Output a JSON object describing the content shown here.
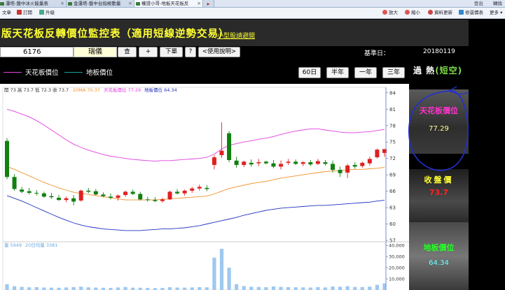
{
  "browser": {
    "tabs": [
      {
        "label": "瀑塔-盤中冰火能量表",
        "active": false
      },
      {
        "label": "金瀑塔-盤中台指極動量",
        "active": false
      },
      {
        "label": "權證小哥-地板天花板反",
        "active": true
      }
    ],
    "window_buttons": [
      "登出",
      "轉換"
    ],
    "toolbar_left": [
      "文章",
      "訂閱",
      "升級"
    ],
    "toolbar_right": [
      "放大",
      "縮小",
      "資料更新",
      "修還價表",
      "更多"
    ]
  },
  "header": {
    "title": "版天花板反轉價位監控表（適用短線逆勢交易）",
    "guide_link": "小型股請避開"
  },
  "controls": {
    "stock_code": "6176",
    "stock_name": "瑞儀",
    "query_button": "查",
    "add_button": "+",
    "order_button": "下單",
    "help_q": "?",
    "help_button": "<使用說明>",
    "base_date_label": "基準日：",
    "base_date_value": "20180119"
  },
  "legend": {
    "ceiling_label": "天花板價位",
    "floor_label": "地板價位",
    "periods": [
      "60日",
      "半年",
      "一年",
      "三年"
    ]
  },
  "right_panel": {
    "status_label": "過 熱",
    "status_short": "(短空)",
    "ceiling_title": "天花板價位",
    "ceiling_value": "77.29",
    "close_title": "收盤價",
    "close_value": "73.7",
    "floor_title": "地板價位",
    "floor_value": "64.34"
  },
  "colors": {
    "ceiling": "#e040e0",
    "floor": "#2030c0",
    "ma20": "#f0902a",
    "up": "#e02020",
    "down": "#108010",
    "volume": "#9ec8f0"
  },
  "chart_data": {
    "type": "candlestick",
    "info_text": "開 73  高 73.7  低 72.3  收 73.7",
    "ma_label": "20MA 70.37",
    "ceiling_label": "天花板價位 77.29",
    "floor_label": "地板價位 64.34",
    "volume_label": "量 5949",
    "volume_ma_label": "20日均量 3381",
    "price_ticks": [
      57,
      60,
      63,
      66,
      69,
      72,
      75,
      78,
      81,
      84
    ],
    "ylim": [
      57,
      85
    ],
    "volume_ticks": [
      "10,000",
      "20,000",
      "30,000",
      "40,000"
    ],
    "volume_ylim": [
      0,
      42000
    ],
    "ohlc": [
      [
        75.2,
        75.7,
        68.2,
        68.6
      ],
      [
        68.6,
        69.1,
        66.1,
        66.4
      ],
      [
        66.3,
        66.8,
        65.6,
        65.9
      ],
      [
        66.0,
        66.6,
        65.4,
        65.7
      ],
      [
        65.7,
        66.2,
        65.2,
        65.6
      ],
      [
        65.6,
        65.9,
        64.8,
        65.0
      ],
      [
        65.1,
        65.7,
        64.6,
        64.9
      ],
      [
        64.8,
        65.3,
        64.2,
        64.4
      ],
      [
        64.4,
        65.0,
        64.0,
        64.7
      ],
      [
        64.7,
        65.3,
        63.4,
        64.1
      ],
      [
        64.3,
        66.3,
        64.1,
        66.1
      ],
      [
        66.1,
        66.6,
        65.6,
        65.9
      ],
      [
        66.0,
        66.4,
        65.2,
        65.4
      ],
      [
        65.4,
        65.8,
        64.9,
        65.1
      ],
      [
        65.0,
        65.6,
        64.5,
        64.8
      ],
      [
        64.8,
        65.4,
        64.3,
        65.2
      ],
      [
        65.3,
        66.1,
        65.0,
        65.9
      ],
      [
        65.9,
        66.3,
        65.3,
        65.5
      ],
      [
        65.5,
        65.9,
        64.3,
        64.5
      ],
      [
        64.5,
        65.0,
        64.1,
        64.4
      ],
      [
        64.4,
        64.9,
        64.0,
        64.2
      ],
      [
        64.2,
        64.8,
        63.9,
        64.5
      ],
      [
        64.5,
        66.1,
        64.4,
        65.9
      ],
      [
        65.9,
        66.4,
        65.4,
        65.6
      ],
      [
        65.6,
        66.3,
        65.2,
        66.1
      ],
      [
        66.1,
        66.8,
        65.7,
        66.5
      ],
      [
        66.5,
        67.2,
        66.1,
        66.8
      ],
      [
        66.6,
        67.1,
        66.0,
        66.4
      ],
      [
        70.8,
        72.6,
        70.0,
        72.2
      ],
      [
        72.6,
        78.6,
        72.1,
        73.4
      ],
      [
        76.6,
        77.0,
        71.3,
        71.7
      ],
      [
        71.6,
        72.3,
        70.3,
        70.8
      ],
      [
        70.8,
        71.6,
        70.4,
        71.4
      ],
      [
        71.2,
        71.8,
        70.5,
        70.9
      ],
      [
        71.1,
        71.9,
        70.6,
        71.3
      ],
      [
        71.4,
        71.6,
        70.9,
        71.1
      ],
      [
        71.1,
        71.7,
        70.2,
        70.5
      ],
      [
        70.5,
        71.6,
        70.0,
        71.0
      ],
      [
        71.2,
        71.9,
        70.8,
        71.4
      ],
      [
        71.4,
        71.8,
        70.8,
        71.0
      ],
      [
        71.0,
        71.5,
        70.6,
        71.3
      ],
      [
        71.3,
        71.7,
        70.6,
        70.9
      ],
      [
        71.0,
        71.9,
        70.8,
        71.5
      ],
      [
        71.3,
        71.7,
        70.7,
        71.0
      ],
      [
        71.0,
        71.6,
        69.4,
        69.9
      ],
      [
        69.9,
        70.5,
        68.6,
        69.3
      ],
      [
        69.4,
        71.0,
        68.4,
        70.7
      ],
      [
        70.8,
        71.3,
        70.1,
        70.5
      ],
      [
        70.6,
        71.4,
        70.3,
        71.2
      ],
      [
        71.1,
        72.3,
        70.7,
        71.9
      ],
      [
        72.2,
        73.8,
        72.0,
        73.6
      ],
      [
        73.0,
        73.7,
        72.3,
        73.7
      ]
    ],
    "ceiling_series": [
      81.0,
      80.6,
      80.1,
      79.6,
      78.9,
      78.1,
      77.2,
      76.3,
      75.4,
      74.6,
      74.0,
      73.5,
      73.1,
      72.7,
      72.4,
      72.2,
      72.0,
      71.8,
      71.7,
      71.6,
      71.5,
      71.6,
      71.6,
      71.7,
      71.8,
      71.9,
      72.0,
      72.2,
      72.8,
      73.7,
      74.4,
      74.7,
      75.0,
      75.2,
      75.5,
      75.7,
      76.0,
      76.4,
      76.7,
      77.0,
      77.2,
      77.4,
      77.4,
      77.2,
      77.0,
      76.8,
      76.7,
      76.7,
      76.8,
      76.9,
      77.1,
      77.3
    ],
    "ma20_series": [
      70.5,
      70.0,
      69.4,
      68.8,
      68.2,
      67.6,
      67.1,
      66.6,
      66.2,
      65.8,
      65.6,
      65.4,
      65.2,
      65.0,
      64.8,
      64.6,
      64.4,
      64.4,
      64.4,
      64.4,
      64.4,
      64.5,
      64.6,
      64.7,
      64.8,
      64.9,
      65.0,
      65.1,
      65.5,
      66.0,
      66.5,
      66.8,
      67.1,
      67.4,
      67.6,
      67.8,
      68.1,
      68.4,
      68.6,
      68.8,
      69.0,
      69.2,
      69.4,
      69.6,
      69.7,
      69.8,
      69.9,
      70.0,
      70.0,
      70.1,
      70.2,
      70.37
    ],
    "floor_series": [
      65.2,
      64.7,
      64.2,
      63.6,
      63.0,
      62.4,
      61.8,
      61.2,
      60.7,
      60.2,
      59.8,
      59.5,
      59.3,
      59.1,
      59.0,
      58.9,
      58.8,
      58.8,
      58.8,
      58.9,
      59.0,
      59.1,
      59.1,
      59.2,
      59.3,
      59.5,
      59.7,
      60.0,
      60.3,
      60.6,
      60.9,
      61.2,
      61.6,
      61.9,
      62.2,
      62.5,
      62.7,
      62.9,
      63.0,
      63.1,
      63.2,
      63.3,
      63.4,
      63.4,
      63.5,
      63.6,
      63.7,
      63.8,
      63.9,
      64.0,
      64.2,
      64.34
    ],
    "volume": [
      5200,
      3400,
      2800,
      2400,
      2600,
      2200,
      2100,
      2000,
      2300,
      2600,
      3000,
      2400,
      2200,
      2000,
      1900,
      2300,
      2700,
      2100,
      2000,
      1800,
      1700,
      1900,
      2500,
      2200,
      2100,
      2300,
      2600,
      2400,
      29000,
      37000,
      20000,
      5200,
      3500,
      2900,
      2700,
      2500,
      3200,
      2800,
      2600,
      2400,
      2300,
      2200,
      2600,
      2300,
      3100,
      2900,
      3400,
      2700,
      2600,
      3000,
      4600,
      5949
    ]
  }
}
